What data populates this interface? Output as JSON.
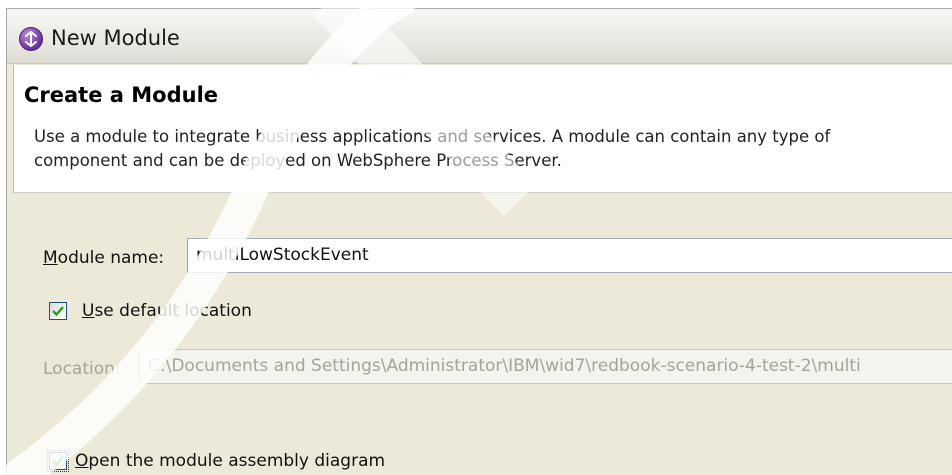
{
  "window": {
    "title": "New Module",
    "icon": "new-module-wizard-icon"
  },
  "header": {
    "title": "Create a Module",
    "description_line1": "Use a module to integrate business applications and services. A module can contain any type of",
    "description_line2": "component and can be deployed on WebSphere Process Server."
  },
  "form": {
    "module_name": {
      "label_prefix": "M",
      "label_rest": "odule name:",
      "value": "multiLowStockEvent"
    },
    "use_default_location": {
      "label_prefix": "U",
      "label_rest": "se default location",
      "checked": true
    },
    "location": {
      "label": "Location:",
      "value": "C:\\Documents and Settings\\Administrator\\IBM\\wid7\\redbook-scenario-4-test-2\\multi",
      "enabled": false
    },
    "open_assembly_diagram": {
      "label_prefix": "O",
      "label_rest": "pen the module assembly diagram",
      "checked": true
    }
  },
  "colors": {
    "dialog_bg": "#ece9d8",
    "checkmark": "#21a121",
    "disabled_text": "#a6a494"
  }
}
